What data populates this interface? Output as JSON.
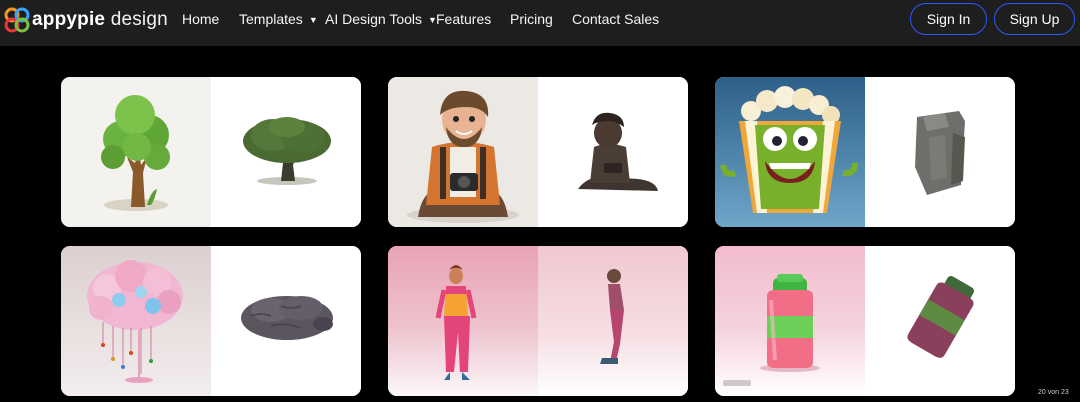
{
  "brand": {
    "name_bold": "appypie",
    "name_light": "design"
  },
  "nav": {
    "items": [
      {
        "label": "Home",
        "has_dropdown": false
      },
      {
        "label": "Templates",
        "has_dropdown": true
      },
      {
        "label": "AI Design Tools",
        "has_dropdown": true
      },
      {
        "label": "Features",
        "has_dropdown": false
      },
      {
        "label": "Pricing",
        "has_dropdown": false
      },
      {
        "label": "Contact Sales",
        "has_dropdown": false
      }
    ],
    "caret_glyph": "▼"
  },
  "auth": {
    "signin_label": "Sign In",
    "signup_label": "Sign Up",
    "button_border_color": "#2b58ff"
  },
  "gallery": {
    "cards": [
      {
        "subject": "tree",
        "right_subject": "tree-3d-model"
      },
      {
        "subject": "photographer-character",
        "right_subject": "character-3d-model"
      },
      {
        "subject": "popcorn-character",
        "right_subject": "popcorn-3d-model"
      },
      {
        "subject": "brain-cloud",
        "right_subject": "brain-3d-model"
      },
      {
        "subject": "standing-woman",
        "right_subject": "woman-3d-model"
      },
      {
        "subject": "jar",
        "right_subject": "jar-3d-model"
      }
    ]
  },
  "colors": {
    "navbar_bg": "#1e1e1e",
    "page_bg": "#000000"
  },
  "page_counter": "20 von 23"
}
